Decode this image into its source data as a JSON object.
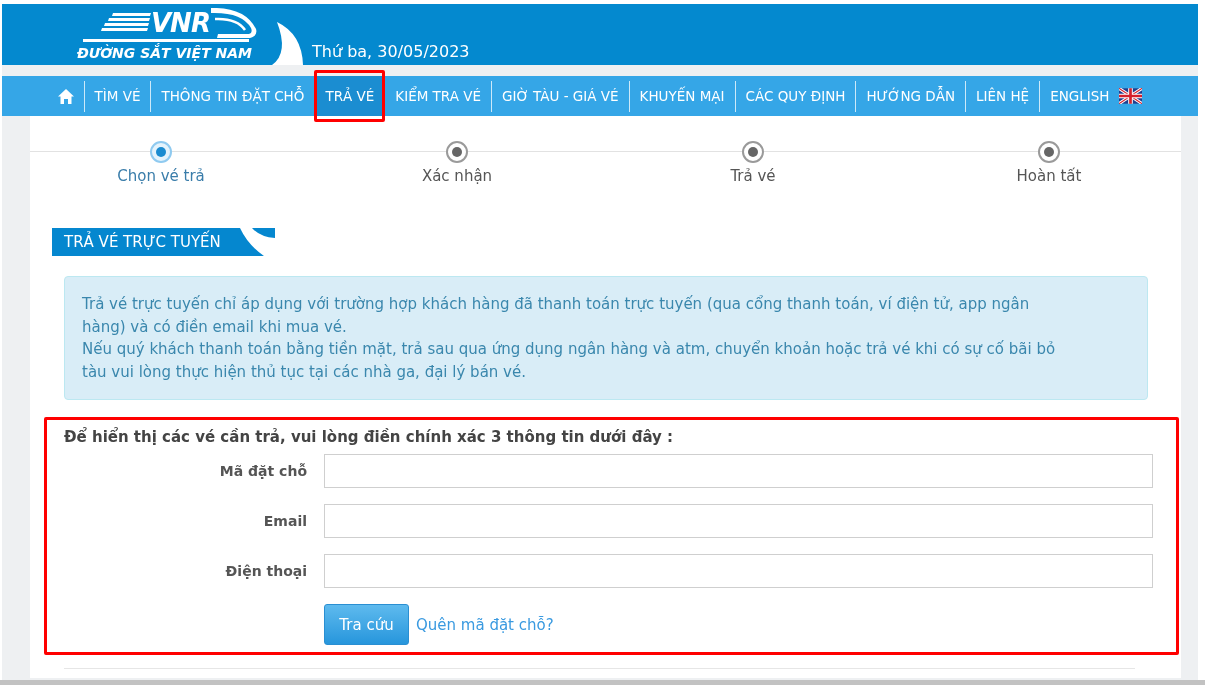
{
  "header": {
    "logo_text": "VNR",
    "logo_tagline": "ĐƯỜNG SẮT VIỆT NAM",
    "date": "Thứ ba, 30/05/2023"
  },
  "nav": {
    "items": [
      {
        "kind": "home",
        "selected": false,
        "highlighted": false
      },
      {
        "kind": "link",
        "label": "TÌM VÉ",
        "selected": false,
        "highlighted": false
      },
      {
        "kind": "link",
        "label": "THÔNG TIN ĐẶT CHỖ",
        "selected": false,
        "highlighted": false
      },
      {
        "kind": "link",
        "label": "TRẢ VÉ",
        "selected": true,
        "highlighted": true
      },
      {
        "kind": "link",
        "label": "KIỂM TRA VÉ",
        "selected": false,
        "highlighted": false
      },
      {
        "kind": "link",
        "label": "GIỜ TÀU - GIÁ VÉ",
        "selected": false,
        "highlighted": false
      },
      {
        "kind": "link",
        "label": "KHUYẾN MẠI",
        "selected": false,
        "highlighted": false
      },
      {
        "kind": "link",
        "label": "CÁC QUY ĐỊNH",
        "selected": false,
        "highlighted": false
      },
      {
        "kind": "link",
        "label": "HƯỚNG DẪN",
        "selected": false,
        "highlighted": false
      },
      {
        "kind": "link",
        "label": "LIÊN HỆ",
        "selected": false,
        "highlighted": false
      },
      {
        "kind": "language",
        "label": "ENGLISH",
        "selected": false,
        "highlighted": false
      }
    ]
  },
  "steps": [
    {
      "label": "Chọn vé trả",
      "selected": true
    },
    {
      "label": "Xác nhận",
      "selected": false
    },
    {
      "label": "Trả vé",
      "selected": false
    },
    {
      "label": "Hoàn tất",
      "selected": false
    }
  ],
  "section_title": "TRẢ VÉ TRỰC TUYẾN",
  "notice": {
    "paragraphs": [
      "Trả vé trực tuyến chỉ áp dụng với trường hợp khách hàng đã thanh toán trực tuyến (qua cổng thanh toán, ví điện tử, app ngân hàng) và có điền email khi mua vé.",
      "Nếu quý khách thanh toán bằng tiền mặt, trả sau qua ứng dụng ngân hàng và atm, chuyển khoản hoặc trả vé khi có sự cố bãi bỏ tàu vui lòng thực hiện thủ tục tại các nhà ga, đại lý bán vé."
    ]
  },
  "form": {
    "highlighted": true,
    "heading": "Để hiển thị các vé cần trả, vui lòng điền chính xác 3 thông tin dưới đây :",
    "fields": [
      {
        "label": "Mã đặt chỗ"
      },
      {
        "label": "Email"
      },
      {
        "label": "Điện thoại"
      }
    ],
    "submit": "Tra cứu",
    "link": "Quên mã đặt chỗ?"
  }
}
